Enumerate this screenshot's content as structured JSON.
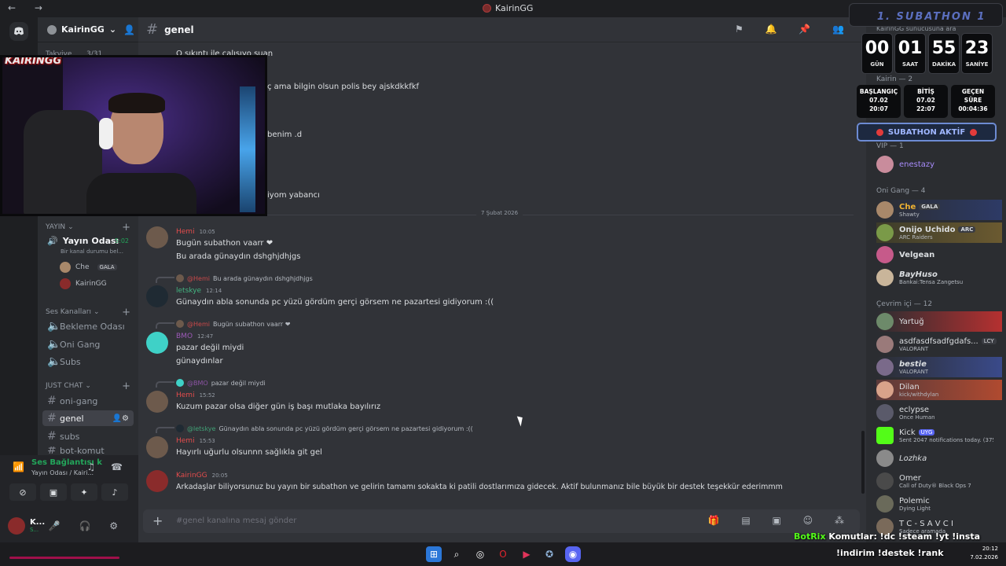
{
  "window": {
    "title": "KairinGG"
  },
  "server": {
    "name": "KairinGG"
  },
  "channel": {
    "name": "genel",
    "placeholder": "#genel kanalına mesaj gönder"
  },
  "sidebar": {
    "partial_top": {
      "label": "Takviye",
      "count": "3/31"
    },
    "cat_yayin": "YAYIN",
    "yayin_odasi": {
      "label": "Yayın Odası",
      "time": "5:02",
      "status": "Bir kanal durumu bel..."
    },
    "voice_users": [
      {
        "name": "Che",
        "badge": "GALA"
      },
      {
        "name": "KairinGG"
      }
    ],
    "cat_ses": "Ses Kanalları",
    "ses_channels": [
      "Bekleme Odası",
      "Oni Gang",
      "Subs"
    ],
    "cat_chat": "JUST CHAT",
    "chat_channels": [
      "oni-gang",
      "genel",
      "subs",
      "bot-komut"
    ]
  },
  "voice_panel": {
    "status": "Ses Bağlantısı k",
    "sub": "Yayın Odası / Kairi..."
  },
  "user_panel": {
    "name": "K...",
    "status": "S..."
  },
  "date_divider": "7 Şubat 2026",
  "messages_partial": [
    "O sıkıntı ile calısıyo suan",
    "ç ama bilgin olsun polis bey ajskdkkfkf",
    "benim .d",
    "iyom yabancı"
  ],
  "messages": [
    {
      "author": "Hemi",
      "time": "10:05",
      "lines": [
        "Bugün subathon vaarr ❤",
        "Bu arada günaydın dshghjdhjgs"
      ],
      "color": "#e44c4c"
    },
    {
      "reply_to": "@Hemi",
      "reply_text": "Bu arada günaydın dshghjdhjgs",
      "author": "letskye",
      "time": "12:14",
      "lines": [
        "Günaydın abla sonunda pc yüzü gördüm gerçi görsem ne pazartesi gidiyorum :(("
      ],
      "color": "#43b581"
    },
    {
      "reply_to": "@Hemi",
      "reply_text": "Bugün subathon vaarr ❤",
      "author": "BMO",
      "time": "12:47",
      "lines": [
        "pazar değil miydi",
        "günaydınlar"
      ],
      "color": "#9b59b6"
    },
    {
      "reply_to": "@BMO",
      "reply_text": "pazar değil miydi",
      "author": "Hemi",
      "time": "15:52",
      "lines": [
        "Kuzum pazar olsa diğer gün iş başı mutlaka bayılırız"
      ],
      "color": "#e44c4c"
    },
    {
      "reply_to": "@letskye",
      "reply_text": "Günaydın abla sonunda pc yüzü gördüm gerçi görsem ne pazartesi gidiyorum :((",
      "author": "Hemi",
      "time": "15:53",
      "lines": [
        "Hayırlı uğurlu olsunnn sağlıkla git gel"
      ],
      "color": "#e44c4c"
    },
    {
      "author": "KairinGG",
      "time": "20:05",
      "lines": [
        "Arkadaşlar biliyorsunuz bu yayın bir subathon ve gelirin tamamı sokakta ki patili dostlarımıza gidecek. Aktif bulunmanız bile büyük bir destek teşekkür ederimmm"
      ],
      "color": "#e44c4c"
    }
  ],
  "members": {
    "partial_lines": [
      "KairinGG sunucusuna ara",
      "Kairin — 2",
      "VIP — 1"
    ],
    "vip": [
      {
        "name": "enestazy",
        "color": "#a78bfa"
      }
    ],
    "oni_header": "Oni Gang — 4",
    "oni": [
      {
        "name": "Che",
        "badge": "GALA",
        "activity": "Shawty",
        "color": "#f0b232"
      },
      {
        "name": "Onijo Uchido",
        "badge": "ARC",
        "activity": "ARC Raiders",
        "color": "#ffffff"
      },
      {
        "name": "Velgean",
        "activity": "",
        "color": "#ffffff"
      },
      {
        "name": "BayHuso",
        "activity": "Bankai:Tensa Zangetsu",
        "color": "#ffffff"
      }
    ],
    "online_header": "Çevrim içi — 12",
    "online": [
      {
        "name": "Yartuğ",
        "activity": "",
        "color": "#dbdee1"
      },
      {
        "name": "asdfasdfsadfgdafs...",
        "badge": "LCY",
        "activity": "VALORANT",
        "color": "#dbdee1"
      },
      {
        "name": "bestie",
        "activity": "VALORANT",
        "color": "#dbdee1"
      },
      {
        "name": "Dilan",
        "activity": "kick/withdylan",
        "color": "#dbdee1"
      },
      {
        "name": "eclypse",
        "activity": "Once Human",
        "color": "#dbdee1"
      },
      {
        "name": "Kick",
        "badge": "UYG",
        "activity": "Sent 2047 notifications today. (375...",
        "color": "#dbdee1"
      },
      {
        "name": "Lozhka",
        "activity": "",
        "color": "#dbdee1"
      },
      {
        "name": "Omer",
        "activity": "Call of Duty® Black Ops 7",
        "color": "#dbdee1"
      },
      {
        "name": "Polemic",
        "activity": "Dying Light",
        "color": "#dbdee1"
      },
      {
        "name": "T C - S A V C I",
        "activity": "Sadece aramada",
        "color": "#dbdee1"
      }
    ]
  },
  "subathon": {
    "title": "1. SUBATHON 1",
    "timer": [
      {
        "value": "00",
        "label": "GÜN"
      },
      {
        "value": "01",
        "label": "SAAT"
      },
      {
        "value": "55",
        "label": "DAKİKA"
      },
      {
        "value": "23",
        "label": "SANİYE"
      }
    ],
    "start": {
      "label": "BAŞLANGIÇ",
      "date": "07.02",
      "time": "20:07"
    },
    "end": {
      "label": "BİTİŞ",
      "date": "07.02",
      "time": "22:07"
    },
    "elapsed": {
      "label": "GEÇEN SÜRE",
      "time": "00:04:36"
    },
    "banner": "SUBATHON AKTİF"
  },
  "webcam": {
    "logo": "KAIRINGG"
  },
  "overlay": {
    "bot": "BotRix",
    "commands_1": "Komutlar: !dc !steam !yt !insta",
    "commands_2": "!indirim !destek !rank"
  },
  "clock": {
    "time": "20:12",
    "date": "7.02.2026"
  }
}
